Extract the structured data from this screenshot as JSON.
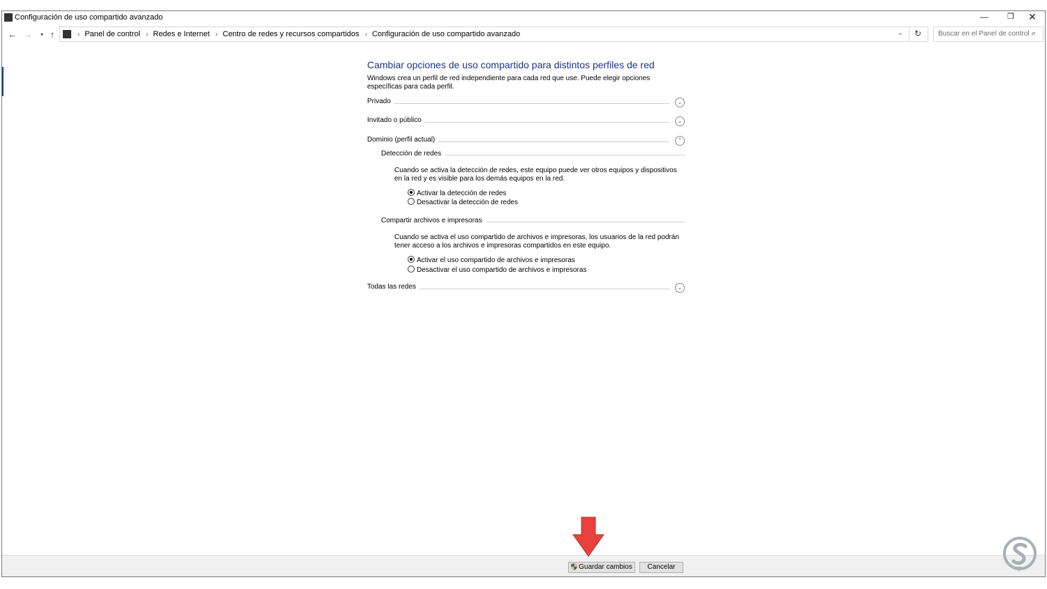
{
  "window": {
    "title": "Configuración de uso compartido avanzado",
    "minimize_glyph": "—",
    "maximize_glyph": "❐",
    "close_glyph": "✕"
  },
  "nav": {
    "back_glyph": "←",
    "forward_glyph": "→",
    "recent_glyph": "▾",
    "up_glyph": "↑",
    "breadcrumb_sep": "›",
    "breadcrumbs": [
      "Panel de control",
      "Redes e Internet",
      "Centro de redes y recursos compartidos",
      "Configuración de uso compartido avanzado"
    ],
    "dropdown_glyph": "⌄",
    "refresh_glyph": "↻",
    "search_placeholder": "Buscar en el Panel de control",
    "search_glyph": "⌕"
  },
  "main": {
    "heading": "Cambiar opciones de uso compartido para distintos perfiles de red",
    "intro": "Windows crea un perfil de red independiente para cada red que use. Puede elegir opciones específicas para cada perfil.",
    "sections": [
      {
        "label": "Privado",
        "chevron": "⌄"
      },
      {
        "label": "Invitado o público",
        "chevron": "⌄"
      },
      {
        "label": "Dominio (perfil actual)",
        "chevron": "⌃"
      },
      {
        "label": "Todas las redes",
        "chevron": "⌄"
      }
    ],
    "network_discovery": {
      "title": "Detección de redes",
      "description": "Cuando se activa la detección de redes, este equipo puede ver otros equipos y dispositivos en la red y es visible para los demás equipos en la red.",
      "options": [
        {
          "label": "Activar la detección de redes",
          "checked": true
        },
        {
          "label": "Desactivar la detección de redes",
          "checked": false
        }
      ]
    },
    "file_sharing": {
      "title": "Compartir archivos e impresoras",
      "description": "Cuando se activa el uso compartido de archivos e impresoras, los usuarios de la red podrán tener acceso a los archivos e impresoras compartidos en este equipo.",
      "options": [
        {
          "label": "Activar el uso compartido de archivos e impresoras",
          "checked": true
        },
        {
          "label": "Desactivar el uso compartido de archivos e impresoras",
          "checked": false
        }
      ]
    }
  },
  "footer": {
    "save_label": "Guardar cambios",
    "cancel_label": "Cancelar"
  },
  "colors": {
    "heading": "#1e3287",
    "arrow": "#e8413b",
    "logo": "#9aa3a8"
  }
}
